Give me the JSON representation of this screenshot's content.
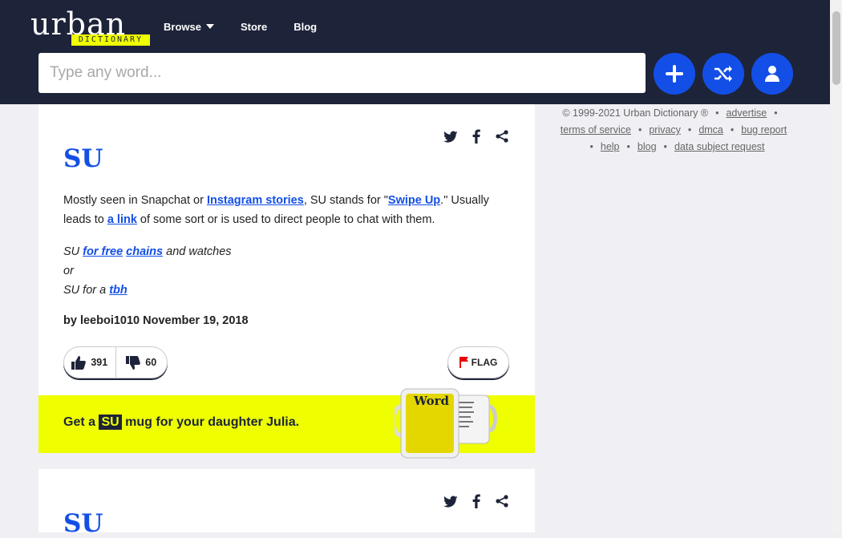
{
  "header": {
    "logo_word": "urban",
    "logo_sub": "DICTIONARY",
    "nav": [
      {
        "label": "Browse",
        "has_dropdown": true
      },
      {
        "label": "Store"
      },
      {
        "label": "Blog"
      }
    ],
    "search_placeholder": "Type any word...",
    "buttons": [
      "add-icon",
      "random-shuffle-icon",
      "user-icon"
    ],
    "accent_color": "#134fe6",
    "bg_color": "#1d2439"
  },
  "definitions": [
    {
      "word": "SU",
      "meaning": {
        "t1": "Mostly seen in Snapchat or ",
        "l1": "Instagram stories",
        "t2": ", SU stands for \"",
        "l2": "Swipe Up",
        "t3": ".\" Usually leads to ",
        "l3": "a link",
        "t4": " of some sort or is used to direct people to chat with them."
      },
      "example": {
        "t1": "SU ",
        "l1": "for free",
        "t2": " ",
        "l2": "chains",
        "t3": " and watches",
        "line2": "or",
        "t4": "SU for a ",
        "l3": "tbh"
      },
      "contributor": {
        "by": "by",
        "author": "leeboi1010",
        "date": "November 19, 2018"
      },
      "upvotes": "391",
      "downvotes": "60",
      "flag_label": "FLAG",
      "mug": {
        "pre": "Get a ",
        "word": "SU",
        "post": " mug for your daughter Julia.",
        "mug_label": "Word"
      }
    },
    {
      "word": "SU"
    }
  ],
  "footer": {
    "copyright": "© 1999-2021 Urban Dictionary ®",
    "links": [
      "advertise",
      "terms of service",
      "privacy",
      "dmca",
      "bug report",
      "help",
      "blog",
      "data subject request"
    ]
  }
}
